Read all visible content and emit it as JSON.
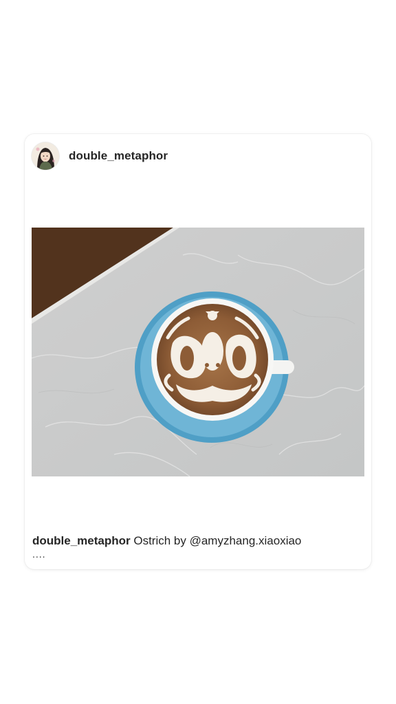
{
  "post": {
    "username": "double_metaphor",
    "caption_user": "double_metaphor",
    "caption_text": "Ostrich by @amyzhang.xiaoxiao",
    "more": "....",
    "avatar_icon": "profile-avatar-icon",
    "image_subject": "latte-art-photo"
  },
  "colors": {
    "card_bg": "#ffffff",
    "text": "#262626",
    "saucer": "#6fb5d6",
    "coffee": "#8a5a35"
  }
}
